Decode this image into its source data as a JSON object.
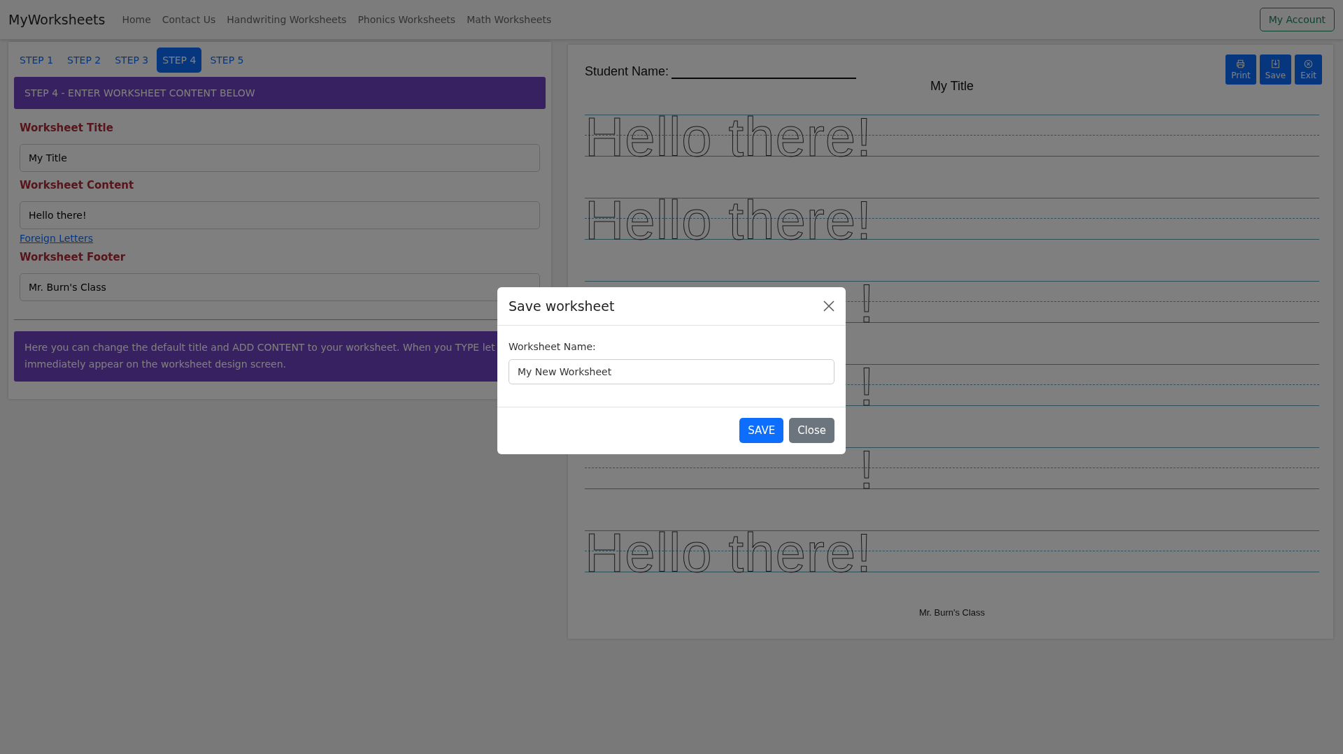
{
  "navbar": {
    "brand": "MyWorksheets",
    "links": [
      "Home",
      "Contact Us",
      "Handwriting Worksheets",
      "Phonics Worksheets",
      "Math Worksheets"
    ],
    "account_button": "My Account"
  },
  "steps": [
    {
      "label": "STEP 1",
      "selected": false
    },
    {
      "label": "STEP 2",
      "selected": false
    },
    {
      "label": "STEP 3",
      "selected": false
    },
    {
      "label": "STEP 4",
      "selected": true
    },
    {
      "label": "STEP 5",
      "selected": false
    }
  ],
  "step_header": "STEP 4 - ENTER WORKSHEET CONTENT BELOW",
  "fields": [
    {
      "label": "Worksheet Title",
      "value": "My Title"
    },
    {
      "label": "Worksheet Content",
      "value": "Hello there!",
      "link": "Foreign Letters"
    },
    {
      "label": "Worksheet Footer",
      "value": "Mr. Burn's Class"
    }
  ],
  "info_lines": [
    "Here you can change the default title and ADD CONTENT to your worksheet. When you TYPE let",
    "immediately appear on the worksheet design screen."
  ],
  "worksheet": {
    "student_label": "Student Name:",
    "title": "My Title",
    "toolbar": [
      {
        "label": "Print",
        "kind": "print"
      },
      {
        "label": "Save",
        "kind": "save"
      },
      {
        "label": "Exit",
        "kind": "exit"
      }
    ],
    "rows": [
      {
        "text": "Hello there!",
        "kind": "full"
      },
      {
        "text": "Hello there!",
        "kind": "full"
      },
      {
        "text": "!",
        "kind": "tail"
      },
      {
        "text": "!",
        "kind": "tail"
      },
      {
        "text": "!",
        "kind": "tail"
      },
      {
        "text": "Hello there!",
        "kind": "full"
      }
    ],
    "footer": "Mr. Burn's Class"
  },
  "modal": {
    "title": "Save worksheet",
    "field_label": "Worksheet Name:",
    "value": "My New Worksheet",
    "buttons": [
      {
        "label": "SAVE",
        "kind": "primary"
      },
      {
        "label": "Close",
        "kind": "secondary"
      }
    ]
  }
}
